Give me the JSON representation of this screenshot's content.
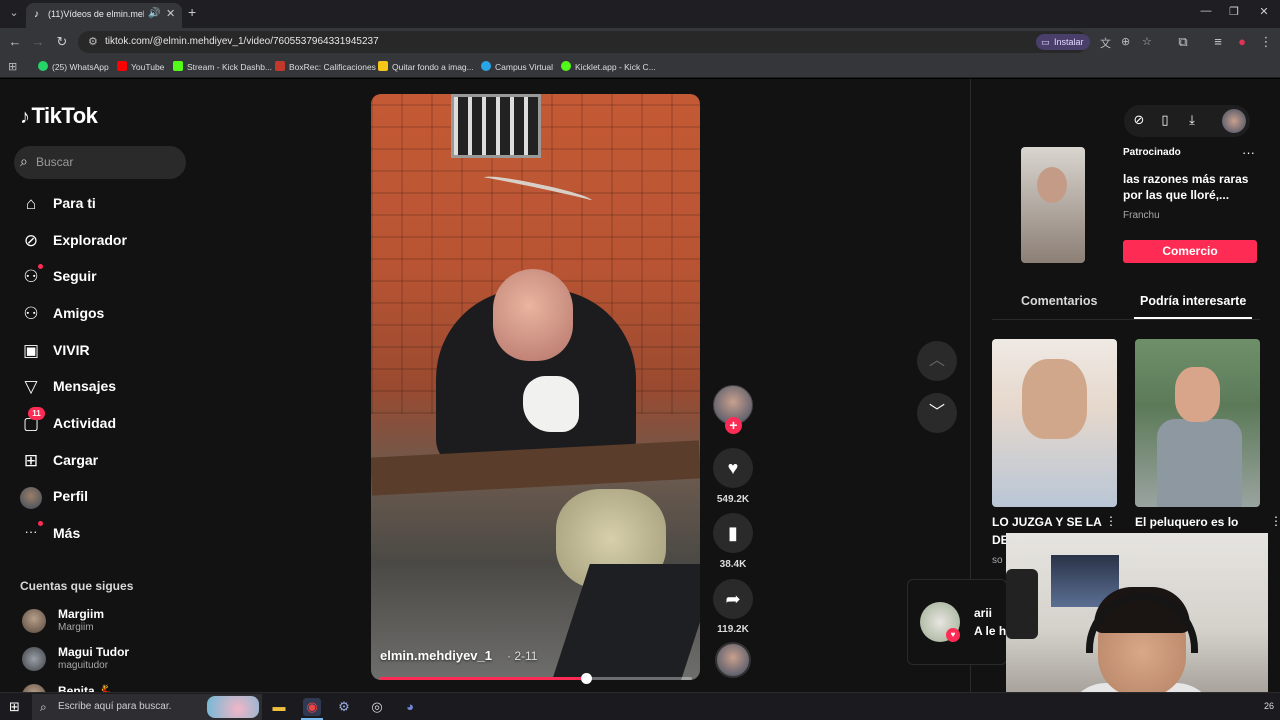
{
  "browser": {
    "tab_title": "(11)Vídeos de elmin.mehdiy...",
    "url": "tiktok.com/@elmin.mehdiyev_1/video/7605537964331945237",
    "install_label": "Instalar",
    "bookmarks": [
      {
        "label": "(25) WhatsApp",
        "color": "#25d366"
      },
      {
        "label": "YouTube",
        "color": "#ff0000"
      },
      {
        "label": "Stream - Kick Dashb...",
        "color": "#53fc18"
      },
      {
        "label": "BoxRec: Calificaciones",
        "color": "#c0392b"
      },
      {
        "label": "Quitar fondo a imag...",
        "color": "#f5c518"
      },
      {
        "label": "Campus Virtual",
        "color": "#2aa6e8"
      },
      {
        "label": "Kicklet.app - Kick C...",
        "color": "#53fc18"
      }
    ]
  },
  "tiktok": {
    "logo": "TikTok",
    "search_placeholder": "Buscar",
    "nav": [
      {
        "label": "Para ti",
        "icon": "home-icon",
        "glyph": "⌂"
      },
      {
        "label": "Explorador",
        "icon": "compass-icon",
        "glyph": "⊘"
      },
      {
        "label": "Seguir",
        "icon": "user-follow-icon",
        "glyph": "⚇"
      },
      {
        "label": "Amigos",
        "icon": "friends-icon",
        "glyph": "⚇"
      },
      {
        "label": "VIVIR",
        "icon": "live-icon",
        "glyph": "▣"
      },
      {
        "label": "Mensajes",
        "icon": "send-icon",
        "glyph": "▽"
      },
      {
        "label": "Actividad",
        "icon": "inbox-icon",
        "glyph": "▢",
        "badge": "11"
      },
      {
        "label": "Cargar",
        "icon": "upload-icon",
        "glyph": "⊞"
      },
      {
        "label": "Perfil",
        "icon": "avatar",
        "glyph": ""
      },
      {
        "label": "Más",
        "icon": "more-icon",
        "glyph": "···"
      }
    ],
    "following_title": "Cuentas que sigues",
    "following": [
      {
        "name": "Margiim",
        "handle": "Margiim"
      },
      {
        "name": "Magui Tudor",
        "handle": "maguitudor"
      },
      {
        "name": "Benita 💃",
        "handle": ""
      }
    ]
  },
  "video": {
    "author": "elmin.mehdiyev_1",
    "date": "· 2-11",
    "progress": 0.66,
    "likes": "549.2K",
    "saves": "38.4K",
    "shares": "119.2K"
  },
  "panel": {
    "sponsored": "Patrocinado",
    "ad_title": "las razones más raras por las que lloré,...",
    "ad_brand": "Franchu",
    "ad_cta": "Comercio",
    "tab_comments": "Comentarios",
    "tab_interest": "Podría interesarte",
    "card1_title": "LO JUZGA Y SE LA",
    "card1_line2": "DE",
    "card1_sub": "so",
    "card2_title": "El peluquero es lo"
  },
  "notification": {
    "name": "arii",
    "text": "A le h"
  },
  "taskbar": {
    "search_placeholder": "Escribe aquí para buscar.",
    "clock": "26"
  }
}
